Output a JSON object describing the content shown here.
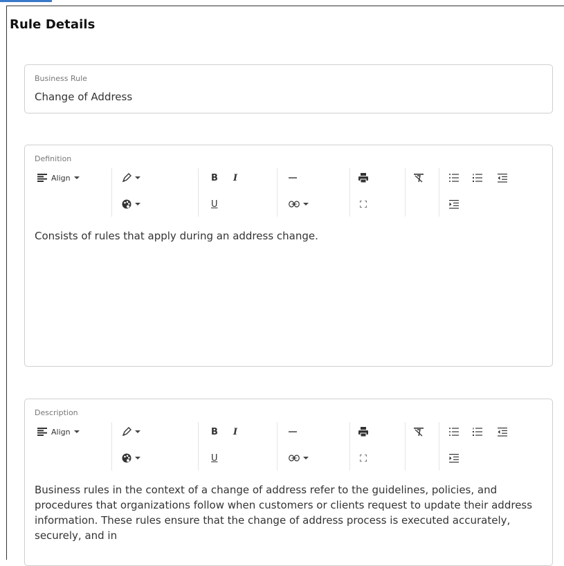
{
  "panel": {
    "title": "Rule Details"
  },
  "business_rule": {
    "label": "Business Rule",
    "value": "Change of Address"
  },
  "toolbar": {
    "align_label": "Align",
    "bold_label": "B",
    "italic_label": "I",
    "underline_label": "U"
  },
  "definition": {
    "label": "Definition",
    "content": "Consists of rules that apply during an address change."
  },
  "description": {
    "label": "Description",
    "content": "Business rules in the context of a change of address refer to the guidelines, policies, and procedures that organizations follow when customers or clients request to update their address information. These rules ensure that the change of address process is executed accurately, securely, and in"
  },
  "icons": [
    "align-left-icon",
    "pencil-icon",
    "palette-icon",
    "bold-icon",
    "italic-icon",
    "underline-icon",
    "horizontal-rule-icon",
    "link-icon",
    "print-icon",
    "fullscreen-icon",
    "clear-format-icon",
    "bullet-list-icon",
    "numbered-list-icon",
    "outdent-icon",
    "indent-icon"
  ]
}
